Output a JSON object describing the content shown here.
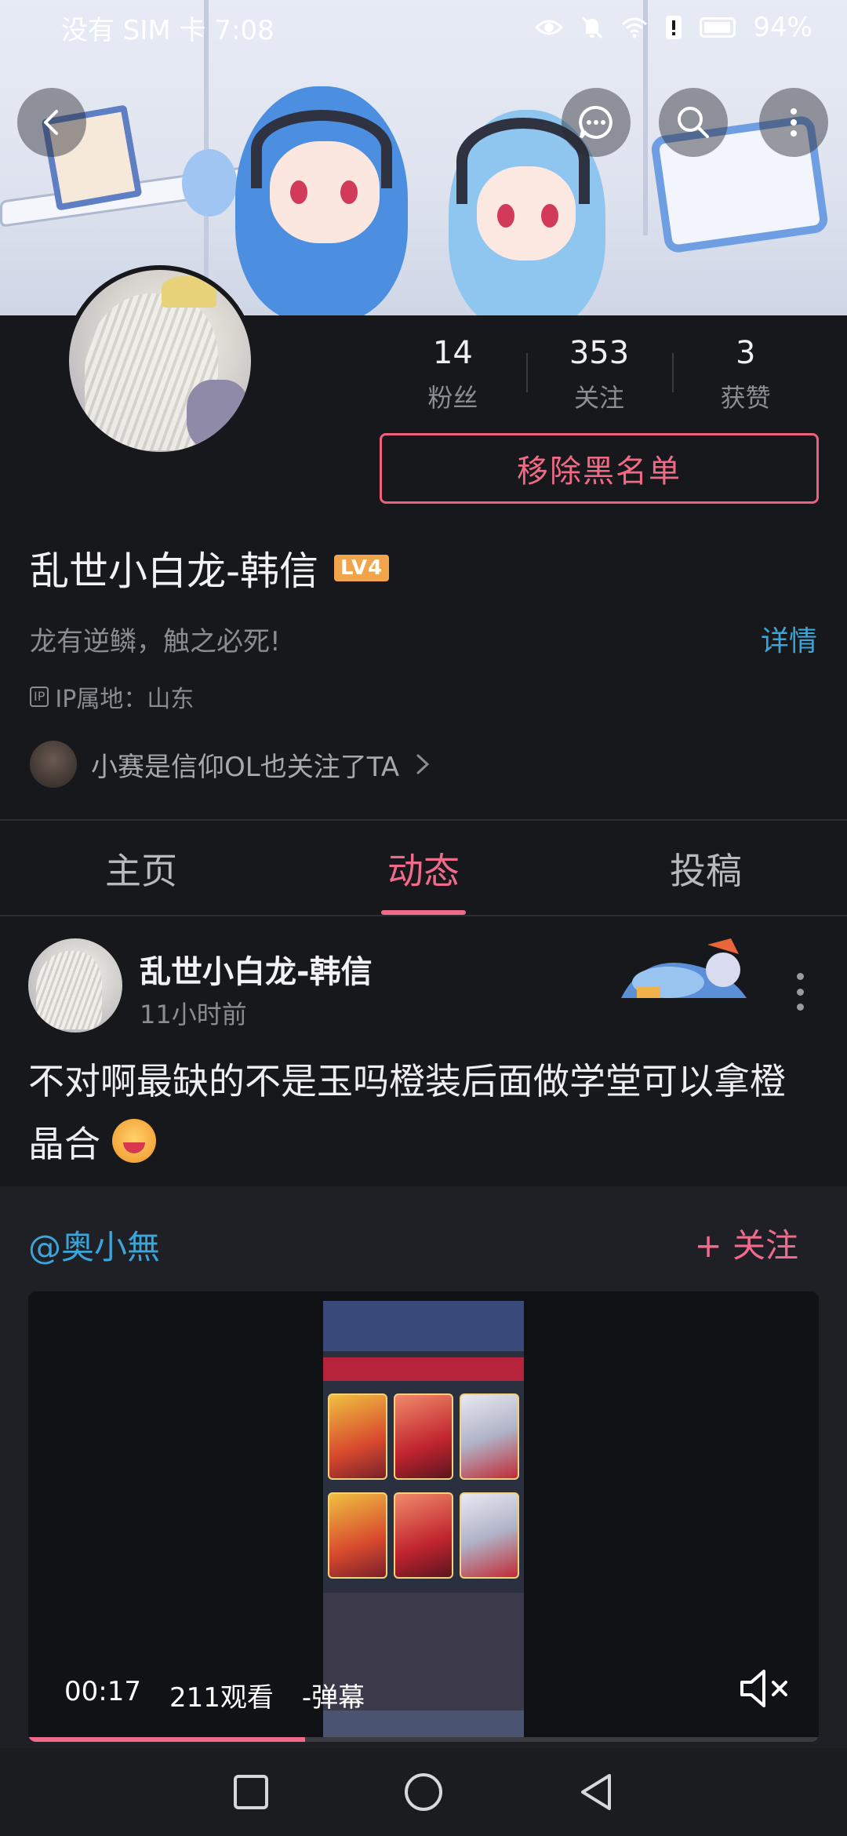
{
  "status_bar": {
    "carrier_time": "没有 SIM 卡 7:08",
    "battery": "94%",
    "icons": [
      "eye-icon",
      "bell-off-icon",
      "wifi-icon",
      "alert-icon",
      "battery-icon"
    ]
  },
  "header": {
    "back_icon": "back-arrow-icon",
    "actions": [
      "message-icon",
      "search-icon",
      "more-vertical-icon"
    ]
  },
  "profile": {
    "stats": [
      {
        "value": "14",
        "label": "粉丝"
      },
      {
        "value": "353",
        "label": "关注"
      },
      {
        "value": "3",
        "label": "获赞"
      }
    ],
    "unblock_label": "移除黑名单",
    "name": "乱世小白龙-韩信",
    "level": "LV4",
    "bio": "龙有逆鳞，触之必死!",
    "detail_link": "详情",
    "ip_tag": "IP",
    "ip_location": "IP属地：山东",
    "mutual_follow": "小赛是信仰OL也关注了TA"
  },
  "tabs": [
    {
      "label": "主页",
      "active": false
    },
    {
      "label": "动态",
      "active": true
    },
    {
      "label": "投稿",
      "active": false
    }
  ],
  "post": {
    "author": "乱世小白龙-韩信",
    "time": "11小时前",
    "text": "不对啊最缺的不是玉吗橙装后面做学堂可以拿橙晶合"
  },
  "repost": {
    "user": "@奥小無",
    "follow_label": "+ 关注",
    "video": {
      "time": "00:17",
      "views": "211观看",
      "danmaku": "-弹幕",
      "progress": 0.35
    }
  },
  "colors": {
    "accent_pink": "#f06a8c",
    "link_blue": "#3aa5d8",
    "background": "#17181c"
  },
  "nav_bar": [
    "square-recent-icon",
    "circle-home-icon",
    "triangle-back-icon"
  ]
}
